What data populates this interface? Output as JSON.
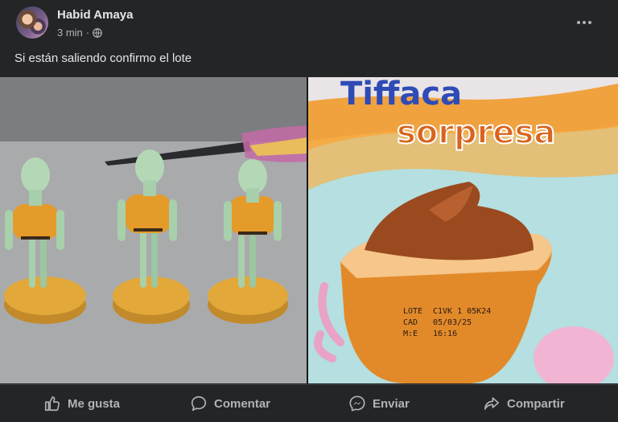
{
  "post": {
    "author": "Habid Amaya",
    "time": "3 min",
    "separator": "·",
    "caption": "Si están saliendo confirmo el lote"
  },
  "photo_right_text": {
    "brand_top": "Tiffaca",
    "sorpresa": "sorpresa",
    "lote_label": "LOTE",
    "lote_value": "C1VK  1 05K24",
    "cad_label": "CAD",
    "cad_value": "05/03/25",
    "me_label": "M:E",
    "me_value": "16:16"
  },
  "actions": {
    "like": "Me gusta",
    "comment": "Comentar",
    "send": "Enviar",
    "share": "Compartir"
  },
  "icons": {
    "privacy": "globe-icon",
    "more": "more-options-icon",
    "like": "thumbs-up-icon",
    "comment": "comment-bubble-icon",
    "send": "messenger-icon",
    "share": "share-arrow-icon"
  },
  "colors": {
    "background": "#242526",
    "text_primary": "#e4e6eb",
    "text_secondary": "#b0b3b8",
    "divider": "#3e4042"
  }
}
